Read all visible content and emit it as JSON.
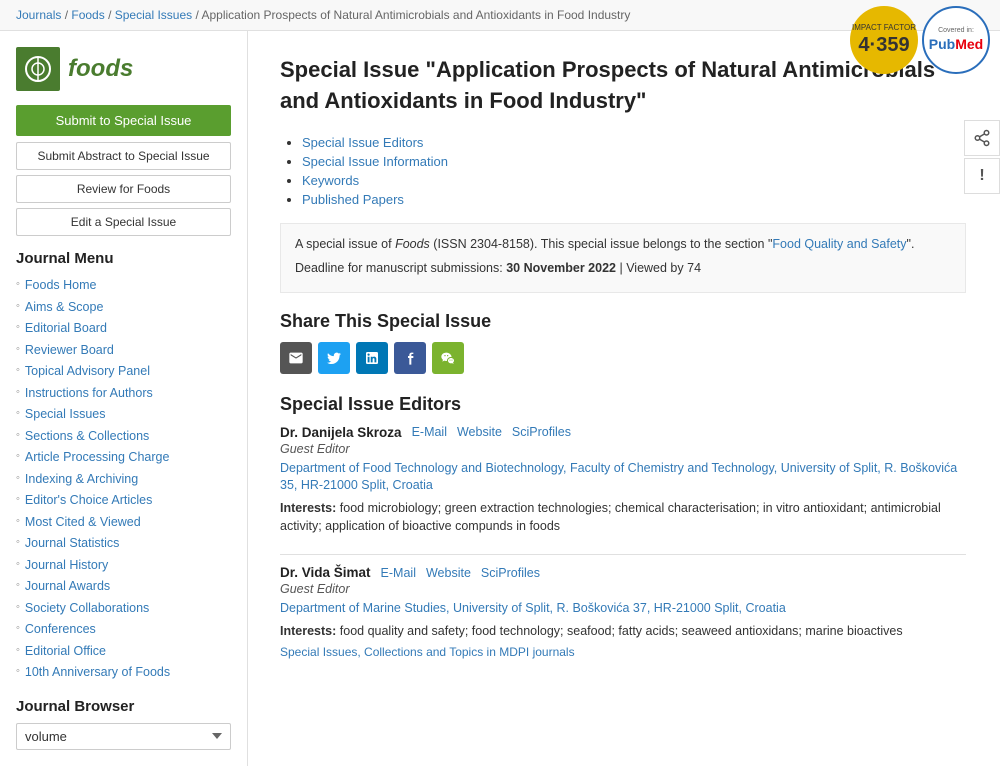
{
  "breadcrumb": {
    "items": [
      {
        "label": "Journals",
        "href": "#"
      },
      {
        "label": "Foods",
        "href": "#"
      },
      {
        "label": "Special Issues",
        "href": "#"
      },
      {
        "label": "Application Prospects of Natural Antimicrobials and Antioxidants in Food Industry",
        "href": "#"
      }
    ]
  },
  "badges": {
    "impact_factor_label": "IMPACT FACTOR",
    "impact_factor_value": "4·359",
    "pubmed_covered": "Covered in:",
    "pubmed_text": "PubMed"
  },
  "side_actions": {
    "share_icon": "⤴",
    "alert_icon": "!"
  },
  "sidebar": {
    "logo_text": "foods",
    "buttons": {
      "submit_special": "Submit to Special Issue",
      "submit_abstract": "Submit Abstract to Special Issue",
      "review": "Review for Foods",
      "edit_special": "Edit a Special Issue"
    },
    "journal_menu_title": "Journal Menu",
    "menu_items": [
      {
        "label": "Foods Home",
        "href": "#"
      },
      {
        "label": "Aims & Scope",
        "href": "#"
      },
      {
        "label": "Editorial Board",
        "href": "#"
      },
      {
        "label": "Reviewer Board",
        "href": "#"
      },
      {
        "label": "Topical Advisory Panel",
        "href": "#"
      },
      {
        "label": "Instructions for Authors",
        "href": "#"
      },
      {
        "label": "Special Issues",
        "href": "#"
      },
      {
        "label": "Sections & Collections",
        "href": "#"
      },
      {
        "label": "Article Processing Charge",
        "href": "#"
      },
      {
        "label": "Indexing & Archiving",
        "href": "#"
      },
      {
        "label": "Editor's Choice Articles",
        "href": "#"
      },
      {
        "label": "Most Cited & Viewed",
        "href": "#"
      },
      {
        "label": "Journal Statistics",
        "href": "#"
      },
      {
        "label": "Journal History",
        "href": "#"
      },
      {
        "label": "Journal Awards",
        "href": "#"
      },
      {
        "label": "Society Collaborations",
        "href": "#"
      },
      {
        "label": "Conferences",
        "href": "#"
      },
      {
        "label": "Editorial Office",
        "href": "#"
      },
      {
        "label": "10th Anniversary of Foods",
        "href": "#"
      }
    ],
    "journal_browser_title": "Journal Browser",
    "browser_select_value": "volume",
    "browser_select_options": [
      "volume"
    ]
  },
  "main": {
    "title": "Special Issue \"Application Prospects of Natural Antimicrobials and Antioxidants in Food Industry\"",
    "toc_links": [
      "Special Issue Editors",
      "Special Issue Information",
      "Keywords",
      "Published Papers"
    ],
    "info_box_line1": "A special issue of Foods (ISSN 2304-8158). This special issue belongs to the section \"Food Quality and Safety\".",
    "info_box_line2": "Deadline for manuscript submissions: 30 November 2022 | Viewed by 74",
    "share_section_title": "Share This Special Issue",
    "editors_section_title": "Special Issue Editors",
    "editors": [
      {
        "name": "Dr. Danijela Skroza",
        "email_label": "E-Mail",
        "website_label": "Website",
        "sciprofiles_label": "SciProfiles",
        "role": "Guest Editor",
        "dept": "Department of Food Technology and Biotechnology, Faculty of Chemistry and Technology, University of Split, R. Boškovića 35, HR-21000 Split, Croatia",
        "interests_label": "Interests:",
        "interests": "food microbiology; green extraction technologies; chemical characterisation; in vitro antioxidant; antimicrobial activity; application of bioactive compunds in foods"
      },
      {
        "name": "Dr. Vida Šimat",
        "email_label": "E-Mail",
        "website_label": "Website",
        "sciprofiles_label": "SciProfiles",
        "role": "Guest Editor",
        "dept": "Department of Marine Studies, University of Split, R. Boškovića 37, HR-21000 Split, Croatia",
        "interests_label": "Interests:",
        "interests": "food quality and safety; food technology; seafood; fatty acids; seaweed antioxidans; marine bioactives",
        "special_issues_link": "Special Issues, Collections and Topics in MDPI journals"
      }
    ]
  }
}
